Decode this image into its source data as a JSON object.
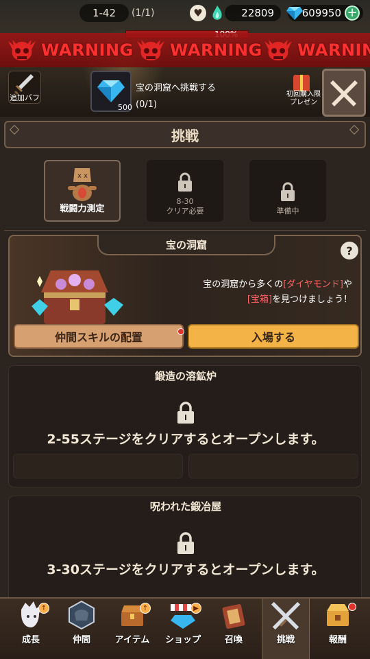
{
  "topbar": {
    "stage": "1-42",
    "stage_count": "(1/1)",
    "resource1": "22809",
    "gems": "609950",
    "hp_percent": "100%"
  },
  "warning": {
    "text": "WARNING"
  },
  "buff": {
    "label": "追加バフ"
  },
  "quest": {
    "gem_amount": "500",
    "title": "宝の洞窟へ挑戦する",
    "progress": "(0/1)"
  },
  "promo": {
    "text": "初回購入限\nプレゼン"
  },
  "panel": {
    "title": "挑戦",
    "tiles": [
      {
        "label": "戦闘力測定",
        "sub": ""
      },
      {
        "label": "クリア必要",
        "sub": "8-30"
      },
      {
        "label": "準備中",
        "sub": ""
      }
    ]
  },
  "treasure": {
    "title": "宝の洞窟",
    "desc_pre": "宝の洞窟から多くの",
    "desc_hl1": "[ダイヤモンド]",
    "desc_mid": "や",
    "desc_hl2": "[宝箱]",
    "desc_post": "を見つけましょう！",
    "btn_skill": "仲間スキルの配置",
    "btn_enter": "入場する"
  },
  "forge": {
    "title": "鍛造の溶鉱炉",
    "message": "2-55ステージをクリアするとオープンします。"
  },
  "cursed": {
    "title": "呪われた鍛冶屋",
    "message": "3-30ステージをクリアするとオープンします。"
  },
  "nav": {
    "items": [
      {
        "label": "成長"
      },
      {
        "label": "仲間"
      },
      {
        "label": "アイテム"
      },
      {
        "label": "ショップ"
      },
      {
        "label": "召喚"
      },
      {
        "label": "挑戦"
      },
      {
        "label": "報酬"
      }
    ]
  },
  "colors": {
    "accent": "#f3b347",
    "warning": "#ff3030",
    "highlight": "#ff6565"
  }
}
